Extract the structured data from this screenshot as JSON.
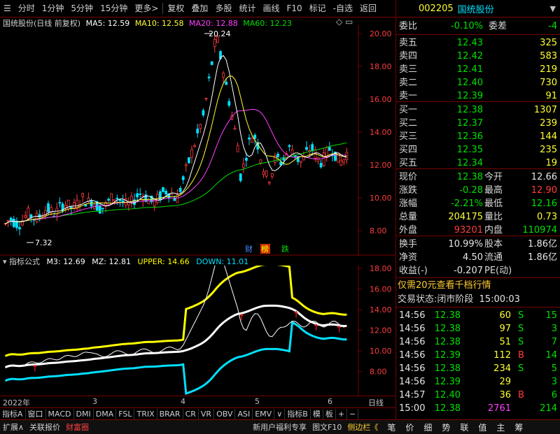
{
  "toolbar": {
    "items": [
      "分时",
      "1分钟",
      "5分钟",
      "15分钟",
      "更多>",
      "复权",
      "叠加",
      "多股",
      "统计",
      "画线",
      "F10",
      "标记",
      "-自选",
      "返回"
    ]
  },
  "stock": {
    "code": "002205",
    "name": "国统股份"
  },
  "main_chart": {
    "title": "国统股份(日线 前复权)",
    "ma5": "MA5: 12.59",
    "ma10": "MA10: 12.58",
    "ma20": "MA20: 12.88",
    "ma60": "MA60: 12.23",
    "y_labels": [
      "20.00",
      "18.00",
      "16.00",
      "14.00",
      "12.00",
      "10.00",
      "8.00"
    ],
    "high_label": "20.24",
    "low_label": "7.32",
    "tags": [
      "财",
      "榜",
      "跌"
    ]
  },
  "indicator_chart": {
    "title": "指标公式",
    "m3": "M3: 12.69",
    "mz": "MZ: 12.81",
    "upper": "UPPER: 14.66",
    "down": "DOWN: 11.01",
    "y_labels": [
      "18.00",
      "16.00",
      "14.00",
      "12.00",
      "10.00",
      "8.00"
    ]
  },
  "x_axis": {
    "labels": [
      "2022年",
      "3",
      "4",
      "5",
      "6"
    ],
    "period": "日线"
  },
  "indicator_tabs": [
    "指标A",
    "窗口",
    "MACD",
    "DMI",
    "DMA",
    "FSL",
    "TRIX",
    "BRAR",
    "CR",
    "VR",
    "OBV",
    "ASI",
    "EMV",
    "∨",
    "指标B",
    "模",
    "板",
    "+",
    "−"
  ],
  "bottom_bar": [
    "扩展∧",
    "关联报价",
    "财富圈",
    "新用户福利专享",
    "图文F10",
    "侧边栏《"
  ],
  "bottom_icons": [
    "笔",
    "价",
    "细",
    "势",
    "联",
    "值",
    "主",
    "筹"
  ],
  "quote": {
    "weibi_label": "委比",
    "weibi": "-0.10%",
    "weicha_label": "委差",
    "weicha": "-4",
    "asks": [
      {
        "label": "卖五",
        "price": "12.43",
        "vol": "325"
      },
      {
        "label": "卖四",
        "price": "12.42",
        "vol": "583"
      },
      {
        "label": "卖三",
        "price": "12.41",
        "vol": "219"
      },
      {
        "label": "卖二",
        "price": "12.40",
        "vol": "730"
      },
      {
        "label": "卖一",
        "price": "12.39",
        "vol": "91"
      }
    ],
    "bids": [
      {
        "label": "买一",
        "price": "12.38",
        "vol": "1307"
      },
      {
        "label": "买二",
        "price": "12.37",
        "vol": "239"
      },
      {
        "label": "买三",
        "price": "12.36",
        "vol": "144"
      },
      {
        "label": "买四",
        "price": "12.35",
        "vol": "235"
      },
      {
        "label": "买五",
        "price": "12.34",
        "vol": "19"
      }
    ],
    "stats": [
      {
        "l1": "现价",
        "v1": "12.38",
        "l2": "今开",
        "v2": "12.66"
      },
      {
        "l1": "涨跌",
        "v1": "-0.28",
        "l2": "最高",
        "v2": "12.90"
      },
      {
        "l1": "涨幅",
        "v1": "-2.21%",
        "l2": "最低",
        "v2": "12.16"
      },
      {
        "l1": "总量",
        "v1": "204175",
        "l2": "量比",
        "v2": "0.73"
      },
      {
        "l1": "外盘",
        "v1": "93201",
        "l2": "内盘",
        "v2": "110974"
      }
    ],
    "stats2": [
      {
        "l1": "换手",
        "v1": "10.99%",
        "l2": "股本",
        "v2": "1.86亿"
      },
      {
        "l1": "净资",
        "v1": "4.50",
        "l2": "流通",
        "v2": "1.86亿"
      },
      {
        "l1": "收益(-)",
        "v1": "-0.207",
        "l2": "PE(动)",
        "v2": ""
      }
    ],
    "promo": "仅需20元查看千档行情",
    "trade_state_label": "交易状态:",
    "trade_state": "闭市阶段",
    "trade_time": "15:00:03",
    "ticks": [
      {
        "t": "14:56",
        "p": "12.38",
        "v": "60",
        "d": "S",
        "n": "15"
      },
      {
        "t": "14:56",
        "p": "12.38",
        "v": "97",
        "d": "S",
        "n": "3"
      },
      {
        "t": "14:56",
        "p": "12.38",
        "v": "51",
        "d": "S",
        "n": "7"
      },
      {
        "t": "14:56",
        "p": "12.39",
        "v": "112",
        "d": "B",
        "n": "14"
      },
      {
        "t": "14:56",
        "p": "12.38",
        "v": "234",
        "d": "S",
        "n": "5"
      },
      {
        "t": "14:56",
        "p": "12.39",
        "v": "29",
        "d": "",
        "n": "3"
      },
      {
        "t": "14:57",
        "p": "12.40",
        "v": "36",
        "d": "B",
        "n": "6"
      },
      {
        "t": "15:00",
        "p": "12.38",
        "v": "2761",
        "d": "",
        "n": "214"
      }
    ]
  },
  "colors": {
    "up": "#ff3b3b",
    "down": "#00e000",
    "ma5": "#ffffff",
    "ma10": "#ffff30",
    "ma20": "#ff40ff",
    "ma60": "#00e000",
    "upper": "#ffff00",
    "down_line": "#00e0ff",
    "mz": "#ffffff"
  }
}
